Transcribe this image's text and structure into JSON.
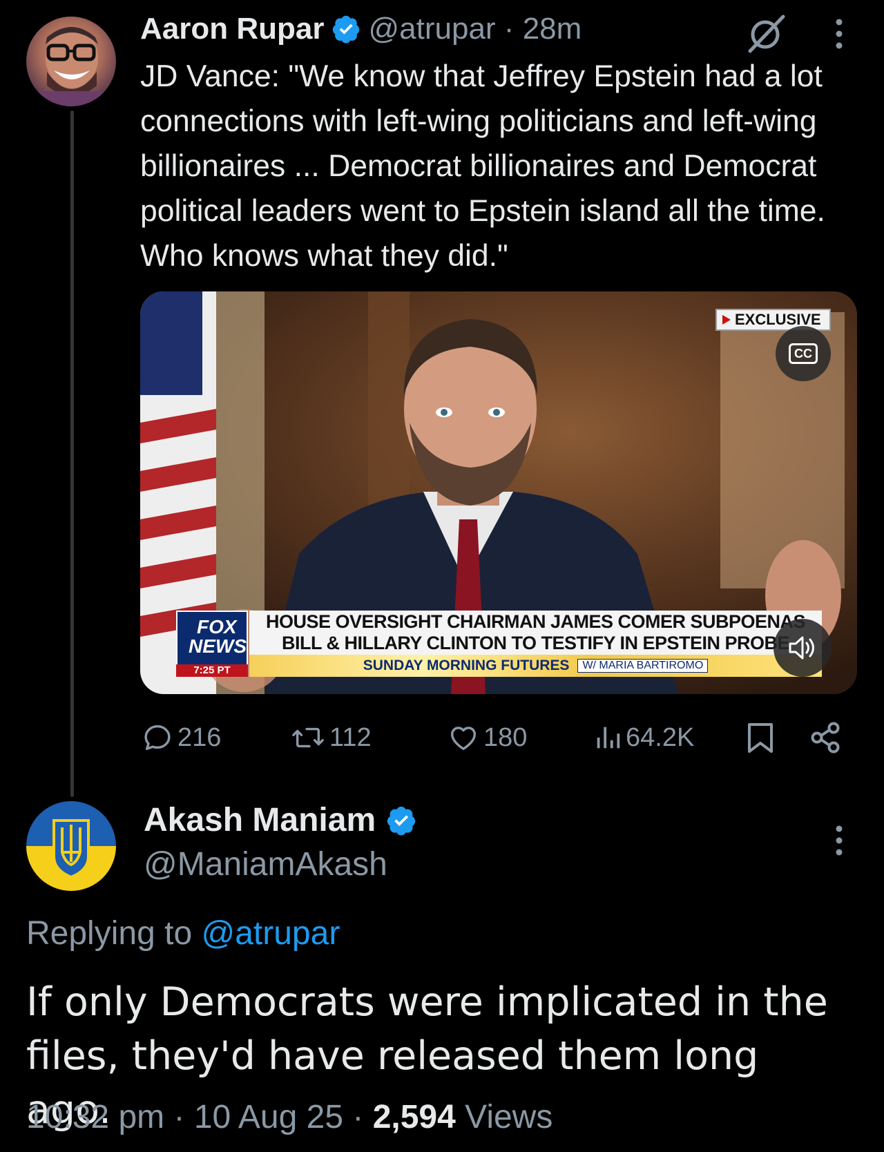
{
  "colors": {
    "background": "#000000",
    "text": "#e7e9ea",
    "muted": "#8b98a5",
    "accent": "#1d9bf0",
    "thread_line": "#333639"
  },
  "parent_tweet": {
    "name": "Aaron Rupar",
    "handle": "@atrupar",
    "separator": "·",
    "time": "28m",
    "text": "JD Vance: \"We know that Jeffrey Epstein had a lot connections with left-wing politicians and left-wing billionaires ... Democrat billionaires and Democrat political leaders went to Epstein island all the time. Who knows what they did.\"",
    "media": {
      "badge": "EXCLUSIVE",
      "cc_label": "CC",
      "network_logo_line1": "FOX",
      "network_logo_line2": "NEWS",
      "clock": "7:25 PT",
      "headline_line1": "HOUSE OVERSIGHT CHAIRMAN JAMES COMER SUBPOENAS",
      "headline_line2": "BILL & HILLARY CLINTON TO TESTIFY IN EPSTEIN PROBE",
      "show_name": "SUNDAY MORNING FUTURES",
      "host_name": "W/ MARIA BARTIROMO"
    },
    "actions": {
      "replies": "216",
      "reposts": "112",
      "likes": "180",
      "views": "64.2K"
    },
    "icons": [
      "verified-badge-icon",
      "grok-icon",
      "more-icon",
      "reply-icon",
      "repost-icon",
      "like-icon",
      "views-icon",
      "bookmark-icon",
      "share-icon",
      "closed-captions-icon",
      "volume-icon"
    ]
  },
  "reply_tweet": {
    "name": "Akash Maniam",
    "handle": "@ManiamAkash",
    "replying_prefix": "Replying to",
    "replying_to": "@atrupar",
    "text": "If only Democrats were implicated in the files, they'd have released them long ago.",
    "time": "10:32 pm",
    "date": "10 Aug 25",
    "sep": "·",
    "views_count": "2,594",
    "views_label": "Views"
  }
}
